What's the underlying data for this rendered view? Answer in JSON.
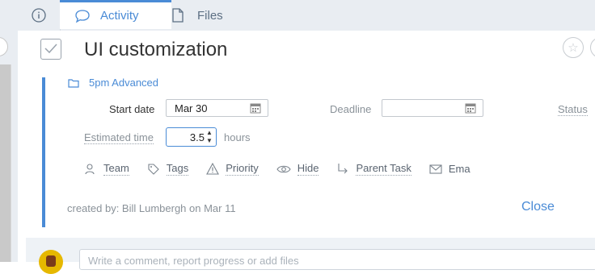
{
  "tabs": {
    "activity": "Activity",
    "files": "Files"
  },
  "task": {
    "title": "UI customization",
    "project": "5pm Advanced"
  },
  "fields": {
    "start_date_label": "Start date",
    "start_date_value": "Mar 30",
    "deadline_label": "Deadline",
    "deadline_value": "",
    "status_label": "Status",
    "estimated_label": "Estimated time",
    "estimated_value": "3.5",
    "estimated_unit": "hours"
  },
  "actions": {
    "team": "Team",
    "tags": "Tags",
    "priority": "Priority",
    "hide": "Hide",
    "parent_task": "Parent Task",
    "email": "Ema"
  },
  "footer": {
    "created_by": "created by: Bill Lumbergh on Mar 11",
    "close": "Close"
  },
  "comment": {
    "placeholder": "Write a comment, report progress or add files"
  },
  "colors": {
    "accent": "#4a8bd6",
    "tab_bg": "#e9edf2"
  },
  "icons": {
    "info": "info-icon",
    "activity": "speech-bubble-icon",
    "files": "file-icon",
    "project": "folder-icon",
    "calendar": "calendar-icon",
    "team": "people-icon",
    "tags": "tag-icon",
    "priority": "warning-icon",
    "hide": "eye-icon",
    "parent": "arrow-turn-icon",
    "email": "envelope-icon",
    "star": "star-icon"
  }
}
